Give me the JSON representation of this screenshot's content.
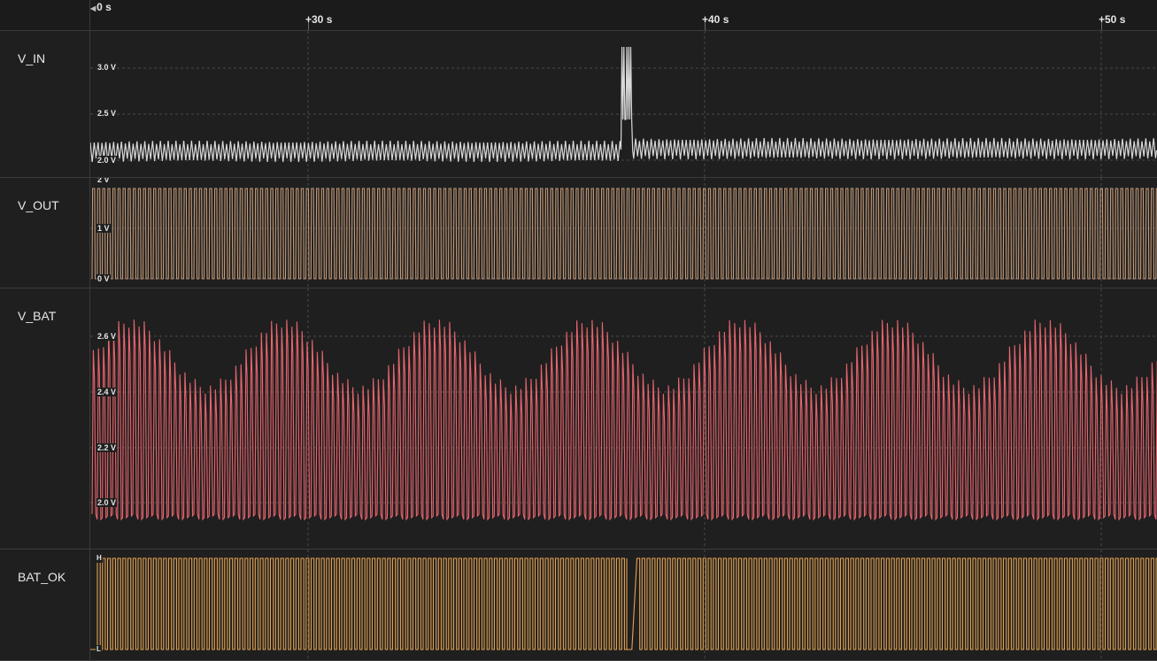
{
  "ruler": {
    "origin_label": "0 s",
    "ticks": [
      {
        "label": "+30 s",
        "t": 30
      },
      {
        "label": "+40 s",
        "t": 40
      },
      {
        "label": "+50 s",
        "t": 50
      }
    ]
  },
  "channels": [
    {
      "name": "V_IN",
      "color": "#d9d9d9",
      "ylabels": [
        "3.0 V",
        "2.5 V",
        "2.0 V"
      ]
    },
    {
      "name": "V_OUT",
      "color": "#c49a78",
      "ylabels": [
        "2 V",
        "1 V",
        "0 V"
      ]
    },
    {
      "name": "V_BAT",
      "color": "#e8656e",
      "ylabels": [
        "2.6 V",
        "2.4 V",
        "2.2 V",
        "2.0 V"
      ]
    },
    {
      "name": "BAT_OK",
      "color": "#e3a352",
      "ylabels": [
        "H",
        "L"
      ]
    }
  ],
  "colors": {
    "background": "#1f1f1f",
    "grid": "#4a4a4a",
    "divider": "#3c3c3c"
  }
}
